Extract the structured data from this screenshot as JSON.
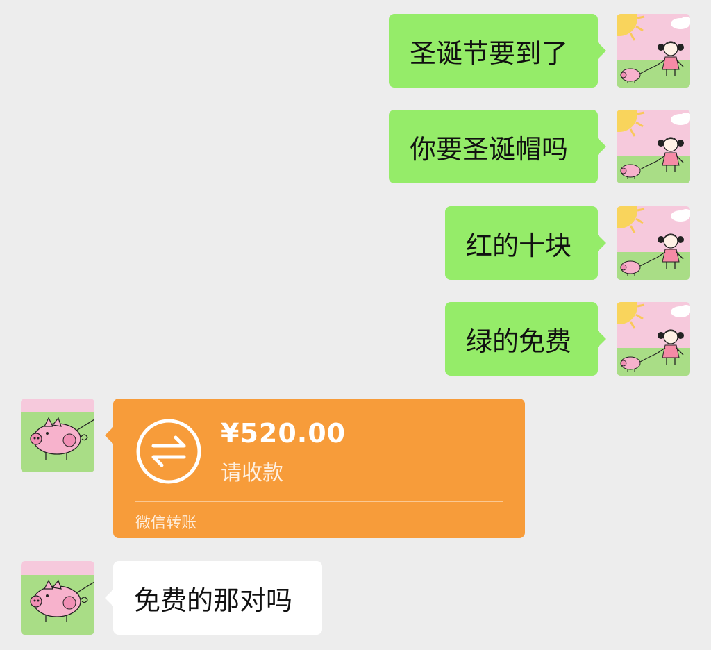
{
  "messages": [
    {
      "side": "right",
      "text": "圣诞节要到了"
    },
    {
      "side": "right",
      "text": "你要圣诞帽吗"
    },
    {
      "side": "right",
      "text": "红的十块"
    },
    {
      "side": "right",
      "text": "绿的免费"
    }
  ],
  "transfer": {
    "amount": "¥520.00",
    "label": "请收款",
    "footer": "微信转账",
    "icon": "transfer-arrows-icon"
  },
  "reply": {
    "side": "left",
    "text": "免费的那对吗"
  },
  "colors": {
    "background": "#ededed",
    "outgoing_bubble": "#95ec69",
    "incoming_bubble": "#ffffff",
    "transfer_card": "#f79c3a"
  },
  "avatars": {
    "self": "girl-with-pig-avatar",
    "other": "pig-avatar"
  }
}
